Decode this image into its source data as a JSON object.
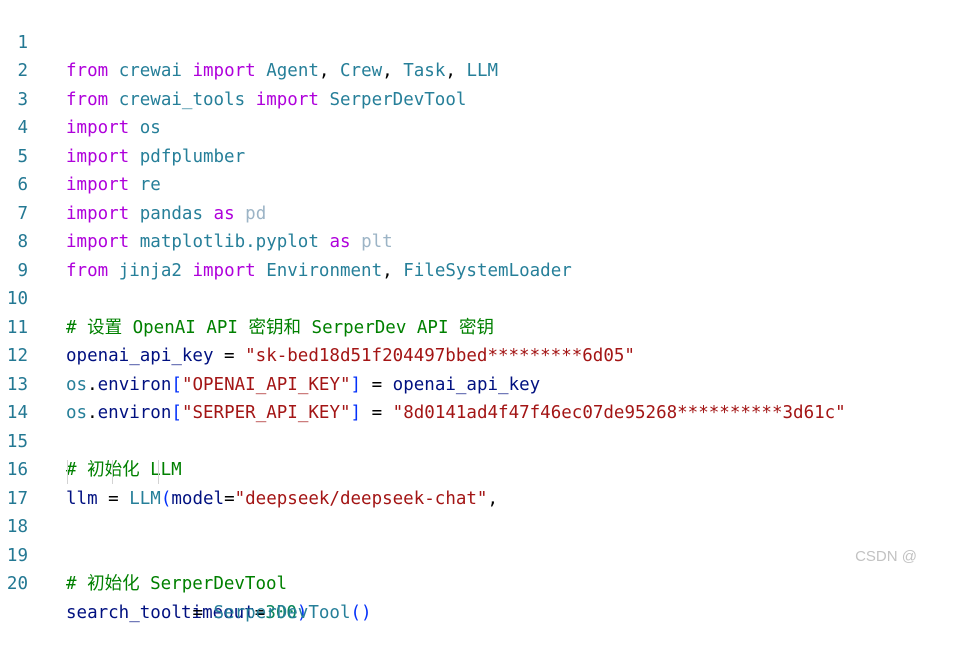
{
  "line_numbers": [
    "1",
    "2",
    "3",
    "4",
    "5",
    "6",
    "7",
    "8",
    "9",
    "10",
    "11",
    "12",
    "13",
    "14",
    "15",
    "16",
    "17",
    "18",
    "19",
    "20"
  ],
  "code": {
    "l1": [
      "from",
      " ",
      "crewai",
      " ",
      "import",
      " ",
      "Agent",
      ", ",
      "Crew",
      ", ",
      "Task",
      ", ",
      "LLM"
    ],
    "l2": [
      "from",
      " ",
      "crewai_tools",
      " ",
      "import",
      " ",
      "SerperDevTool"
    ],
    "l3": [
      "import",
      " ",
      "os"
    ],
    "l4": [
      "import",
      " ",
      "pdfplumber"
    ],
    "l5": [
      "import",
      " ",
      "re"
    ],
    "l6": [
      "import",
      " ",
      "pandas",
      " ",
      "as",
      " ",
      "pd"
    ],
    "l7": [
      "import",
      " ",
      "matplotlib.pyplot",
      " ",
      "as",
      " ",
      "plt"
    ],
    "l8": [
      "from",
      " ",
      "jinja2",
      " ",
      "import",
      " ",
      "Environment",
      ", ",
      "FileSystemLoader"
    ],
    "l10": "# 设置 OpenAI API 密钥和 SerperDev API 密钥",
    "l11": [
      "openai_api_key",
      " = ",
      "\"sk-bed18d51f204497bbed*********6d05\""
    ],
    "l12": [
      "os",
      ".",
      "environ",
      "[",
      "\"OPENAI_API_KEY\"",
      "]",
      " = ",
      "openai_api_key"
    ],
    "l13": [
      "os",
      ".",
      "environ",
      "[",
      "\"SERPER_API_KEY\"",
      "]",
      " = ",
      "\"8d0141ad4f47f46ec07de95268**********3d61c\""
    ],
    "l15": "# 初始化 LLM",
    "l16": [
      "llm",
      " = ",
      "LLM",
      "(",
      "model",
      "=",
      "\"deepseek/deepseek-chat\"",
      ","
    ],
    "l17": [
      "timeout",
      "=",
      "300",
      ")"
    ],
    "l19": "# 初始化 SerperDevTool",
    "l20": [
      "search_tool",
      " = ",
      "SerperDevTool",
      "(",
      ")"
    ]
  },
  "watermark": "CSDN @",
  "colors": {
    "keyword": "#af00db",
    "module": "#267f99",
    "variable": "#001080",
    "string": "#a31515",
    "number": "#098658",
    "comment": "#008000",
    "line_number": "#237893"
  }
}
